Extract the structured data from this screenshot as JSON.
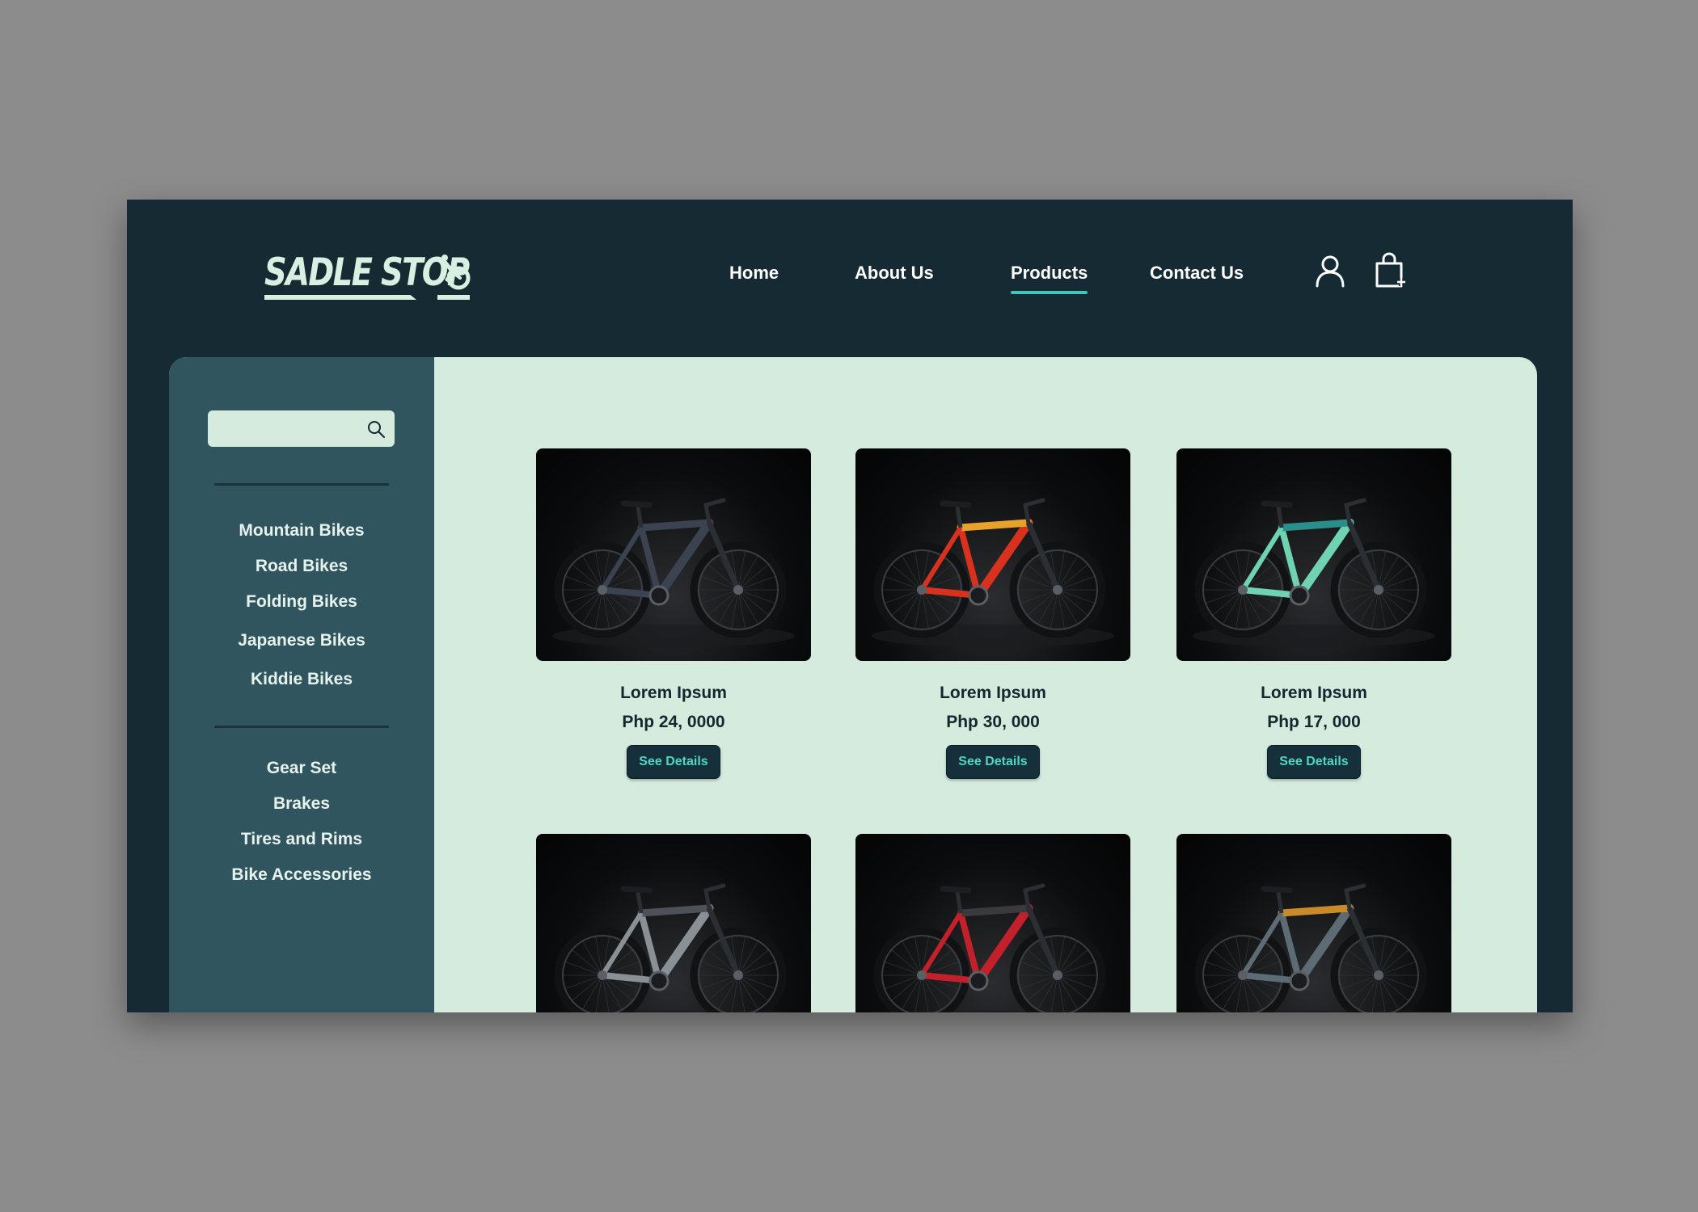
{
  "brand": {
    "name": "SADLE STOP"
  },
  "nav": {
    "items": [
      {
        "label": "Home",
        "active": false
      },
      {
        "label": "About Us",
        "active": false
      },
      {
        "label": "Products",
        "active": true
      },
      {
        "label": "Contact Us",
        "active": false
      }
    ],
    "icons": [
      "user-icon",
      "shopping-bag-icon"
    ]
  },
  "sidebar": {
    "search": {
      "value": "",
      "placeholder": ""
    },
    "bike_categories": [
      "Mountain Bikes",
      "Road Bikes",
      "Folding Bikes",
      "Japanese Bikes",
      "Kiddie Bikes"
    ],
    "part_categories": [
      "Gear Set",
      "Brakes",
      "Tires and Rims",
      "Bike Accessories"
    ]
  },
  "products": [
    {
      "name": "Lorem Ipsum",
      "price": "Php 24, 0000",
      "button": "See Details",
      "frame_color": "#3b4350",
      "accent_color": "#3b4350"
    },
    {
      "name": "Lorem Ipsum",
      "price": "Php 30, 000",
      "button": "See Details",
      "frame_color": "#d8321f",
      "accent_color": "#e8a22a"
    },
    {
      "name": "Lorem Ipsum",
      "price": "Php 17, 000",
      "button": "See Details",
      "frame_color": "#6fd3b1",
      "accent_color": "#2a8f8a"
    },
    {
      "name": "",
      "price": "",
      "button": "",
      "frame_color": "#8a9196",
      "accent_color": "#4c5258"
    },
    {
      "name": "",
      "price": "",
      "button": "",
      "frame_color": "#c2202a",
      "accent_color": "#3a3a3e"
    },
    {
      "name": "",
      "price": "",
      "button": "",
      "frame_color": "#5d6b74",
      "accent_color": "#c98a2a"
    }
  ],
  "colors": {
    "accent": "#3cc7bc",
    "header_bg": "#162a33",
    "sidebar_bg": "#31555f",
    "content_bg": "#d4ebde",
    "button_text": "#4fd7c6"
  }
}
